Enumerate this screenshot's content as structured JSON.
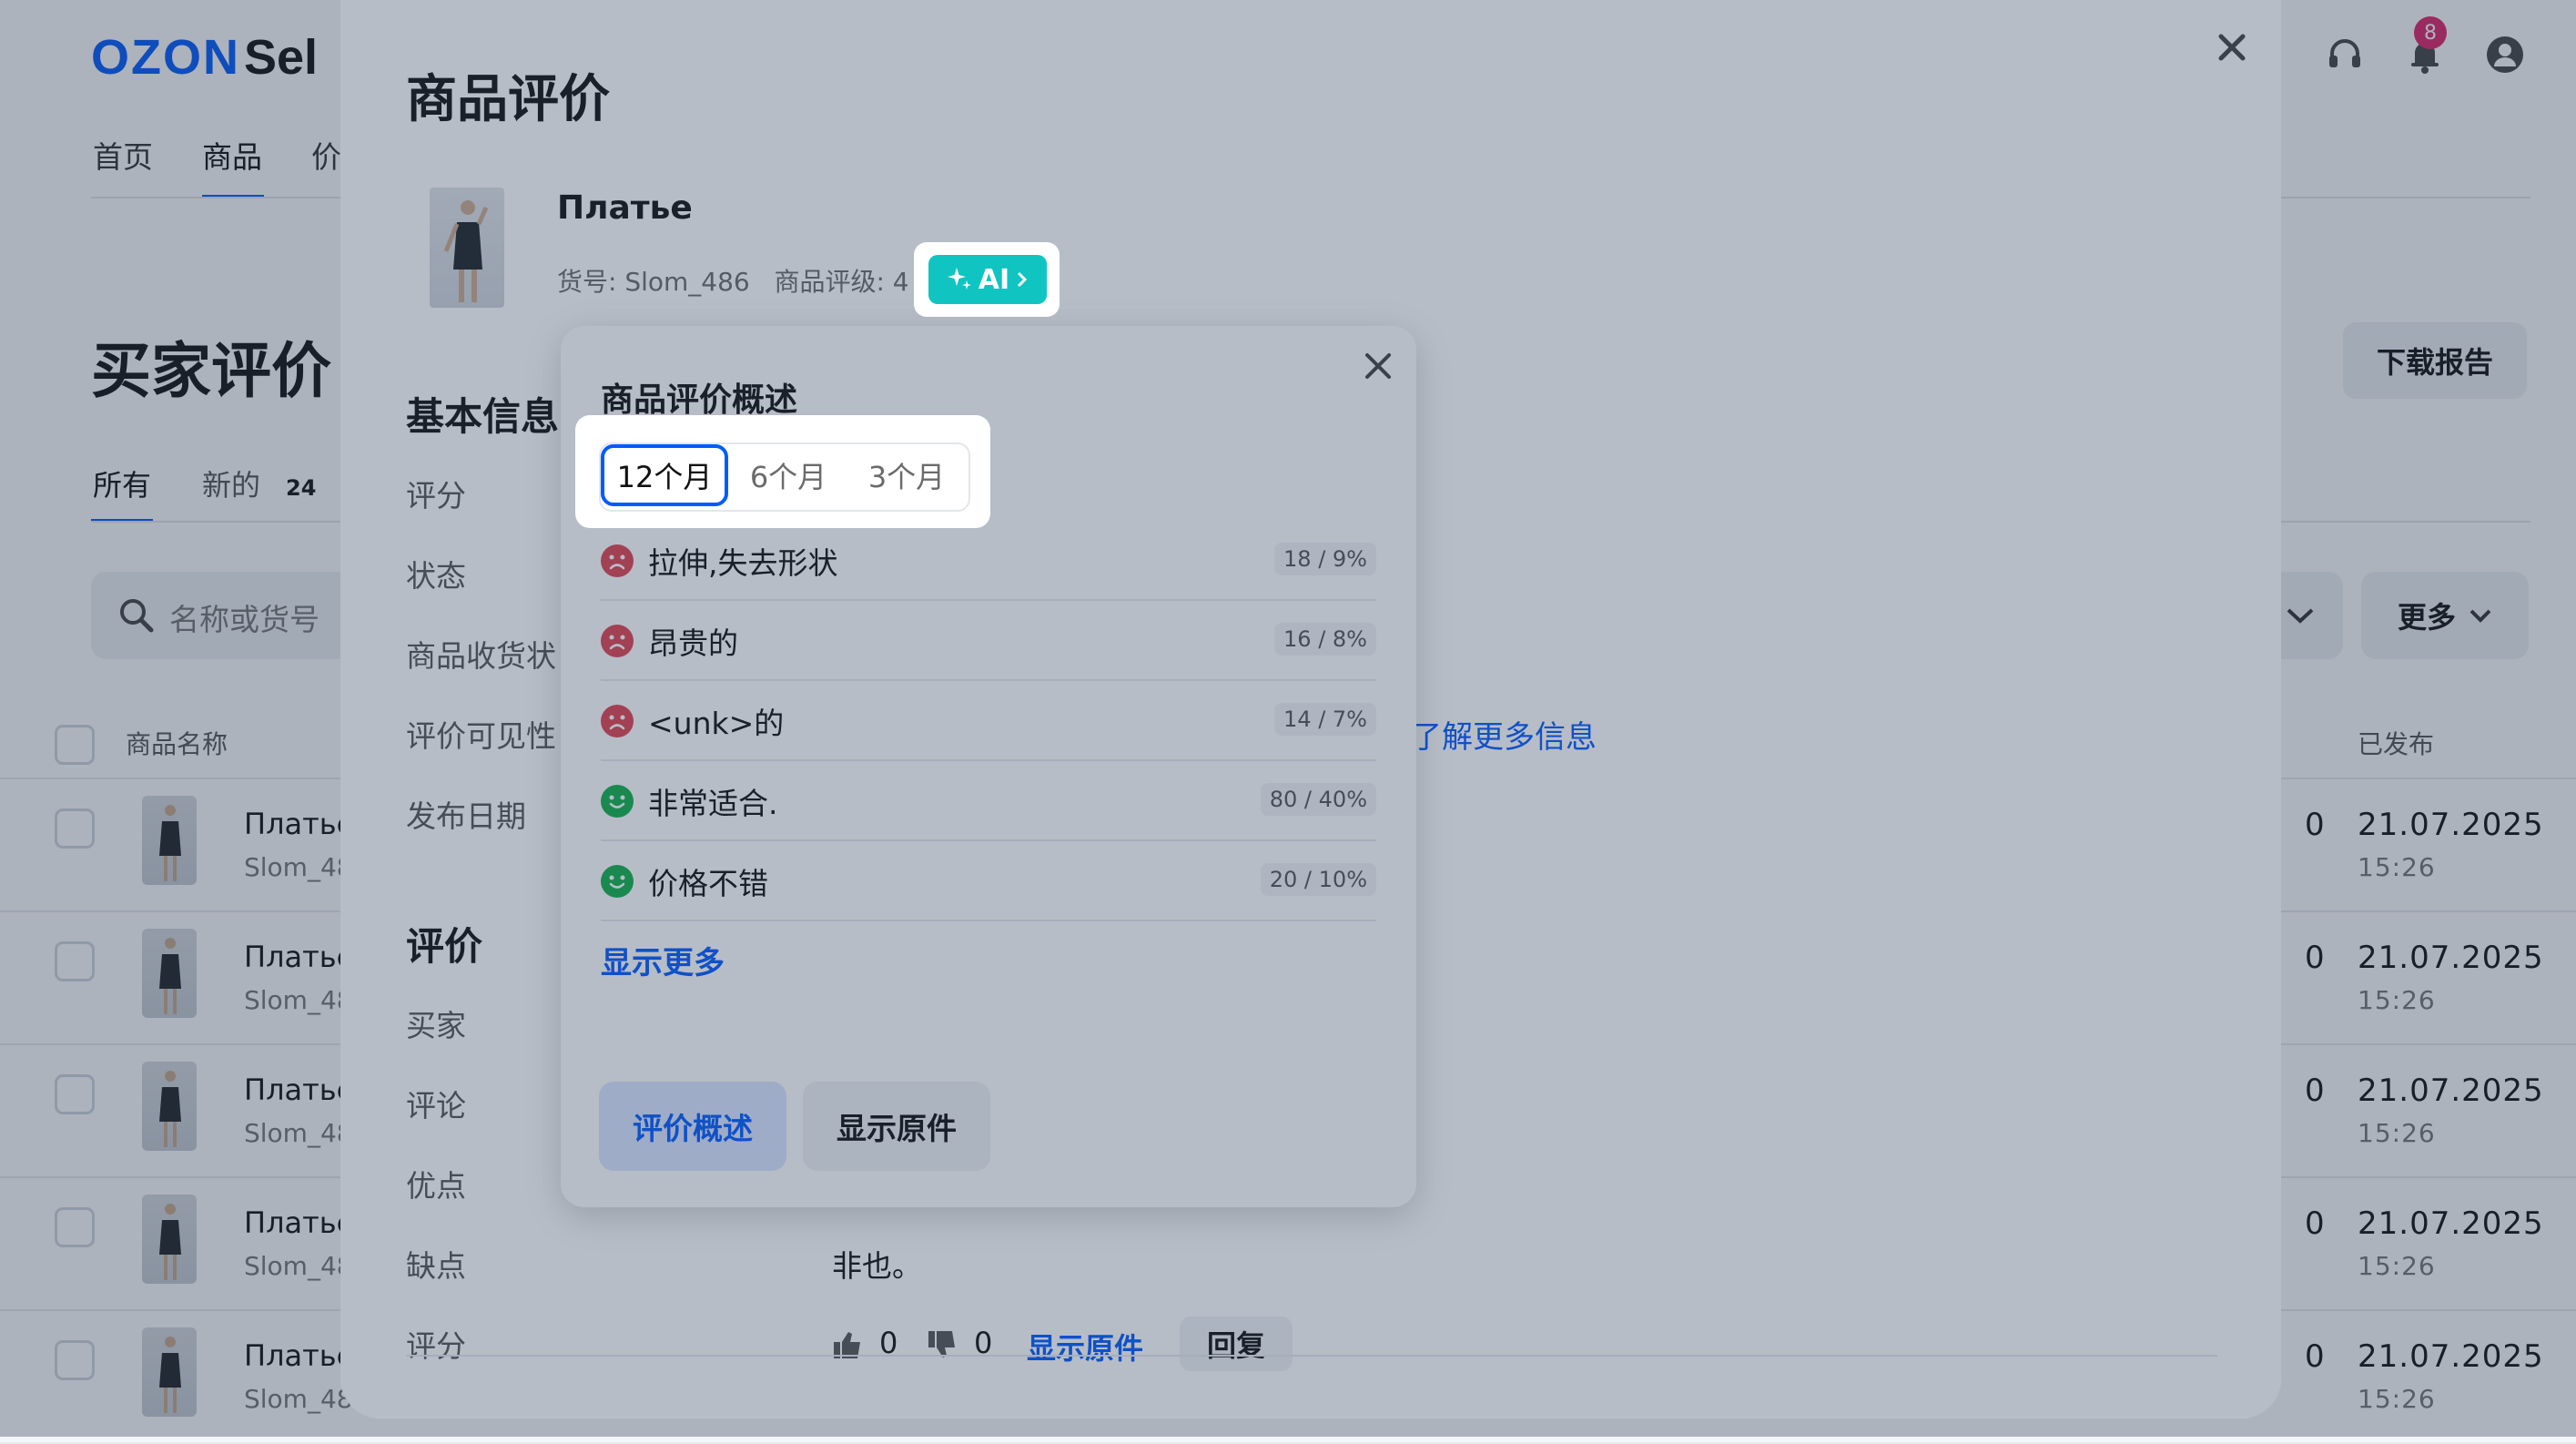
{
  "header": {
    "logo": "OZON",
    "logo_suffix": "Sel",
    "nav": [
      "首页",
      "商品",
      "价"
    ],
    "notification_count": "8"
  },
  "page": {
    "title": "买家评价",
    "download_label": "下载报告",
    "tabs": [
      {
        "label": "所有"
      },
      {
        "label": "新的",
        "count": "24"
      }
    ],
    "search_placeholder": "名称或货号",
    "more_label": "更多",
    "columns": {
      "name": "商品名称",
      "published": "已发布"
    },
    "rows": [
      {
        "name": "Платье",
        "sku": "Slom_48",
        "count": "0",
        "date": "21.07.2025",
        "time": "15:26"
      },
      {
        "name": "Платье",
        "sku": "Slom_48",
        "count": "0",
        "date": "21.07.2025",
        "time": "15:26"
      },
      {
        "name": "Платье",
        "sku": "Slom_48",
        "count": "0",
        "date": "21.07.2025",
        "time": "15:26"
      },
      {
        "name": "Платье",
        "sku": "Slom_48",
        "count": "0",
        "date": "21.07.2025",
        "time": "15:26"
      },
      {
        "name": "Платье",
        "sku": "Slom_48",
        "count": "0",
        "date": "21.07.2025",
        "time": "15:26"
      }
    ]
  },
  "modal": {
    "title": "商品评价",
    "product_name": "Платье",
    "product_meta": "货号: Slom_486   商品评级: 4",
    "ai_label": "AI",
    "basic_info_title": "基本信息",
    "basic_fields": [
      "评分",
      "状态",
      "商品收货状",
      "评价可见性",
      "发布日期"
    ],
    "learn_more": "了解更多信息",
    "review_title": "评价",
    "review_fields": [
      "买家",
      "评论",
      "优点",
      "缺点",
      "评分"
    ],
    "review_text": "非也。",
    "likes": "0",
    "dislikes": "0",
    "show_original_link": "显示原件",
    "reply_label": "回复"
  },
  "summary": {
    "title": "商品评价概述",
    "periods": [
      "12个月",
      "6个月",
      "3个月"
    ],
    "selected_period": "12个月",
    "topics": [
      {
        "label": "拉伸,失去形状",
        "stat": "18 / 9%",
        "sentiment": "negative"
      },
      {
        "label": "昂贵的",
        "stat": "16 / 8%",
        "sentiment": "negative"
      },
      {
        "label": "<unk>的",
        "stat": "14 / 7%",
        "sentiment": "negative"
      },
      {
        "label": "非常适合.",
        "stat": "80 / 40%",
        "sentiment": "positive"
      },
      {
        "label": "价格不错",
        "stat": "20 / 10%",
        "sentiment": "positive"
      }
    ],
    "show_more": "显示更多",
    "btn_summary": "评价概述",
    "btn_original": "显示原件"
  },
  "colors": {
    "accent": "#005bff",
    "ai": "#10c4c2",
    "negative": "#e0444f",
    "positive": "#10b04a"
  }
}
